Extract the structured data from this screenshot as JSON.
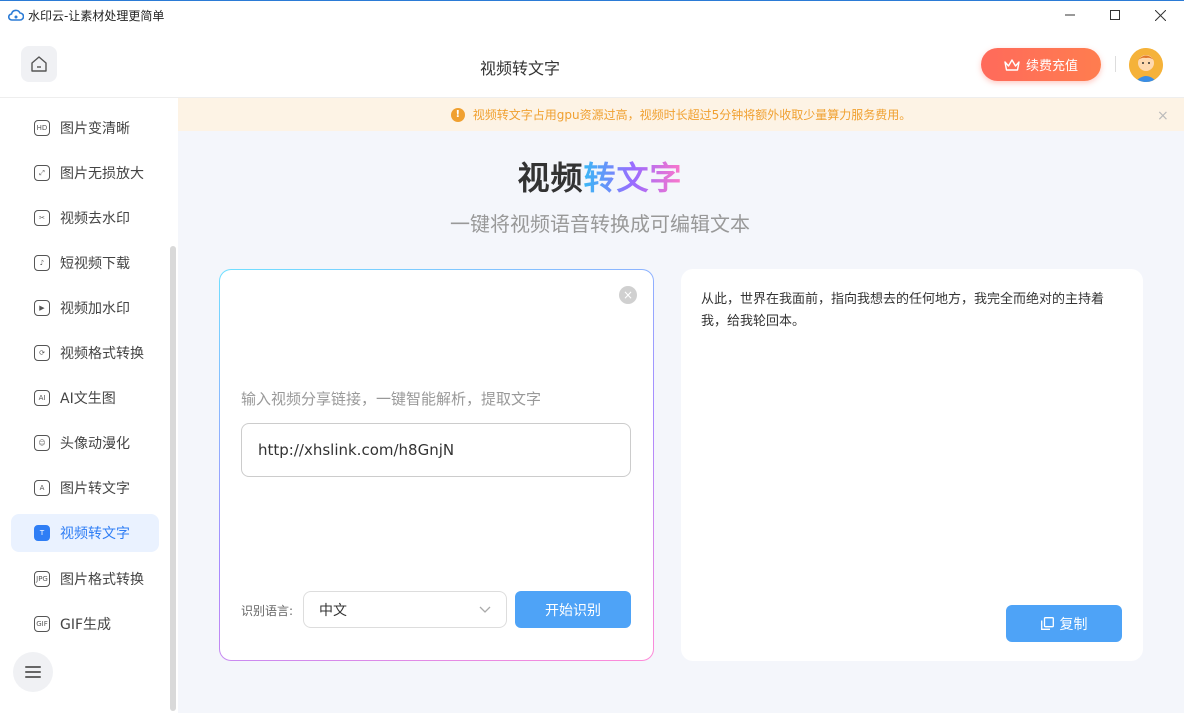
{
  "window": {
    "title": "水印云-让素材处理更简单",
    "min_icon": "minimize-icon",
    "max_icon": "maximize-icon",
    "close_icon": "close-icon"
  },
  "header": {
    "title": "视频转文字",
    "recharge_label": "续费充值"
  },
  "sidebar": {
    "items": [
      {
        "label": "图片变清晰",
        "icon": "HD"
      },
      {
        "label": "图片无损放大",
        "icon": "⤢"
      },
      {
        "label": "视频去水印",
        "icon": "✂"
      },
      {
        "label": "短视频下载",
        "icon": "♪"
      },
      {
        "label": "视频加水印",
        "icon": "▶"
      },
      {
        "label": "视频格式转换",
        "icon": "⟳"
      },
      {
        "label": "AI文生图",
        "icon": "AI"
      },
      {
        "label": "头像动漫化",
        "icon": "☺"
      },
      {
        "label": "图片转文字",
        "icon": "A"
      },
      {
        "label": "视频转文字",
        "icon": "T"
      },
      {
        "label": "图片格式转换",
        "icon": "JPG"
      },
      {
        "label": "GIF生成",
        "icon": "GIF"
      }
    ],
    "active_index": 9
  },
  "notice": {
    "text": "视频转文字占用gpu资源过高，视频时长超过5分钟将额外收取少量算力服务费用。"
  },
  "hero": {
    "title_dark": "视频",
    "title_grad": "转文字",
    "subtitle": "一键将视频语音转换成可编辑文本"
  },
  "input_card": {
    "hint": "输入视频分享链接，一键智能解析，提取文字",
    "url_value": "http://xhslink.com/h8GnjN",
    "lang_label": "识别语言:",
    "lang_value": "中文",
    "start_label": "开始识别"
  },
  "result_card": {
    "text": "从此，世界在我面前，指向我想去的任何地方，我完全而绝对的主持着我，给我轮回本。",
    "copy_label": "复制"
  },
  "colors": {
    "accent": "#4ea3f7",
    "recharge": "#ff6a5b",
    "notice": "#f0a030"
  }
}
